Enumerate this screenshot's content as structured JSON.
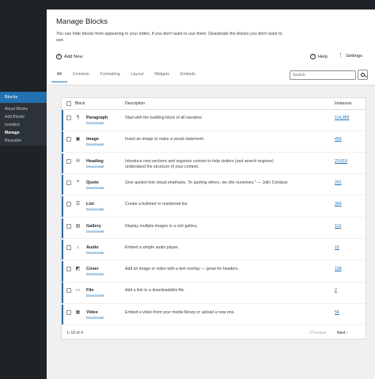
{
  "sidebar": {
    "header": "Blocks",
    "items": [
      {
        "label": "About Blocks"
      },
      {
        "label": "Add Blocks"
      },
      {
        "label": "Installed"
      },
      {
        "label": "Manage"
      },
      {
        "label": "Reusable"
      }
    ]
  },
  "header": {
    "title": "Manage Blocks",
    "description": "You can hide blocks from appearing in your editor, if you don't want to use them. Deactivate the blocks you don't want to see.",
    "add_new": "Add New",
    "help": "Help",
    "settings": "Settings"
  },
  "tabs": [
    "All",
    "Common",
    "Formatting",
    "Layout",
    "Widgets",
    "Embeds"
  ],
  "search": {
    "placeholder": "Search"
  },
  "table": {
    "columns": {
      "block": "Block",
      "description": "Description",
      "instances": "Instances"
    },
    "deactivate_label": "Deactivate",
    "rows": [
      {
        "name": "Paragraph",
        "icon": "paragraph-icon",
        "glyph": "¶",
        "description": "Start with the building block of all narrative.",
        "instances": "114,983"
      },
      {
        "name": "Image",
        "icon": "image-icon",
        "glyph": "▣",
        "description": "Insert an image to make a visual statement.",
        "instances": "456"
      },
      {
        "name": "Heading",
        "icon": "heading-icon",
        "glyph": "H",
        "description": "Introduce new sections and organize content to help visitors (and search engines) understand the structure of your content.",
        "instances": "23,019"
      },
      {
        "name": "Quote",
        "icon": "quote-icon",
        "glyph": "❝",
        "description": "Give quoted text visual emphasis. \"In quoting others, we cite ourselves.\" — Julio Cortázar",
        "instances": "201"
      },
      {
        "name": "List",
        "icon": "list-icon",
        "glyph": "☰",
        "description": "Create a bulleted or numbered list.",
        "instances": "366"
      },
      {
        "name": "Gallery",
        "icon": "gallery-icon",
        "glyph": "▤",
        "description": "Display multiple images in a rich gallery.",
        "instances": "112"
      },
      {
        "name": "Audio",
        "icon": "audio-icon",
        "glyph": "♪",
        "description": "Embed a simple audio player.",
        "instances": "15"
      },
      {
        "name": "Cover",
        "icon": "cover-icon",
        "glyph": "◩",
        "description": "Add an image or video with a text overlay — great for headers.",
        "instances": "108"
      },
      {
        "name": "File",
        "icon": "file-icon",
        "glyph": "▭",
        "description": "Add a link to a downloadable file.",
        "instances": "2"
      },
      {
        "name": "Video",
        "icon": "video-icon",
        "glyph": "▦",
        "description": "Embed a video from your media library or upload a new one.",
        "instances": "56"
      }
    ]
  },
  "pagination": {
    "count": "1–10 of 4",
    "previous": "‹ Previous",
    "next": "Next ›"
  },
  "colors": {
    "accent": "#2271b1",
    "sidebar": "#1d2327"
  }
}
